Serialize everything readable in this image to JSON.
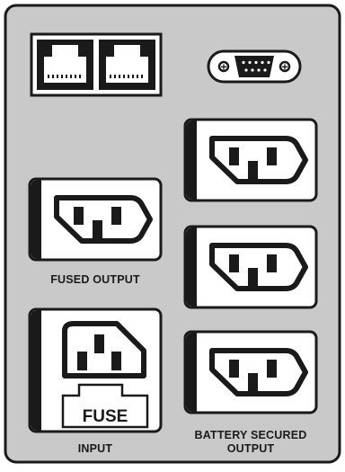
{
  "labels": {
    "fused_output": "FUSED OUTPUT",
    "input": "INPUT",
    "battery_line1": "BATTERY SECURED",
    "battery_line2": "OUTPUT",
    "fuse": "FUSE",
    "port_plus_left": "+",
    "port_plus_right": "+"
  },
  "colors": {
    "panel_fill": "#c9c9c9",
    "ink": "#1a1a1a",
    "white": "#ffffff"
  },
  "icons": {
    "rj_jacks": "network-jack-icon",
    "serial_port": "db9-serial-port-icon",
    "outlet": "iec-c13-outlet-icon",
    "inlet": "iec-c14-inlet-icon"
  }
}
